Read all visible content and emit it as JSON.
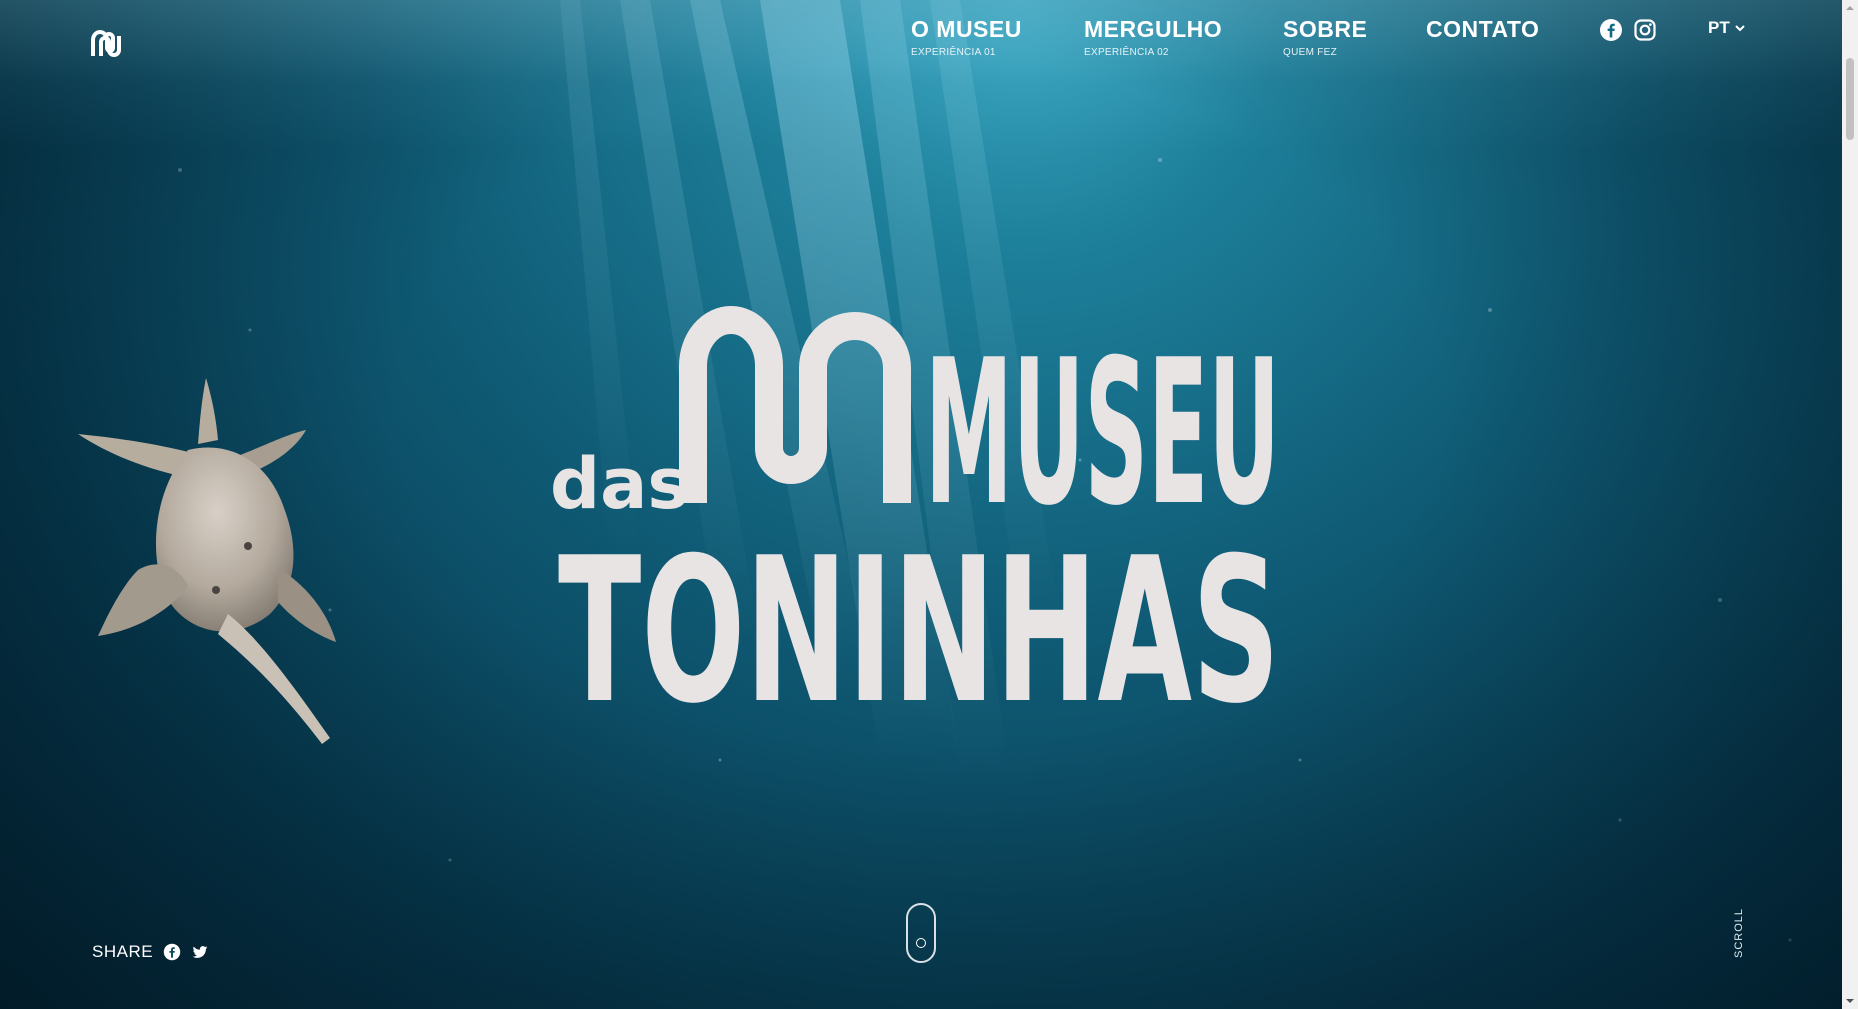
{
  "nav": {
    "items": [
      {
        "label": "O MUSEU",
        "sub": "EXPERIÊNCIA 01"
      },
      {
        "label": "MERGULHO",
        "sub": "EXPERIÊNCIA 02"
      },
      {
        "label": "SOBRE",
        "sub": "QUEM FEZ"
      },
      {
        "label": "CONTATO",
        "sub": ""
      }
    ],
    "social_icons": [
      "facebook-icon",
      "instagram-icon"
    ],
    "language": "PT"
  },
  "hero": {
    "title_prefix": "das",
    "title_line1": "MUSEU",
    "title_line2": "TONINHAS"
  },
  "footer": {
    "share_label": "SHARE",
    "share_icons": [
      "facebook-icon",
      "twitter-icon"
    ],
    "scroll_label": "SCROLL"
  },
  "colors": {
    "water_light": "#3aa6c0",
    "water_deep": "#042a3b",
    "title": "#e9e4e4",
    "text": "#ffffff"
  }
}
